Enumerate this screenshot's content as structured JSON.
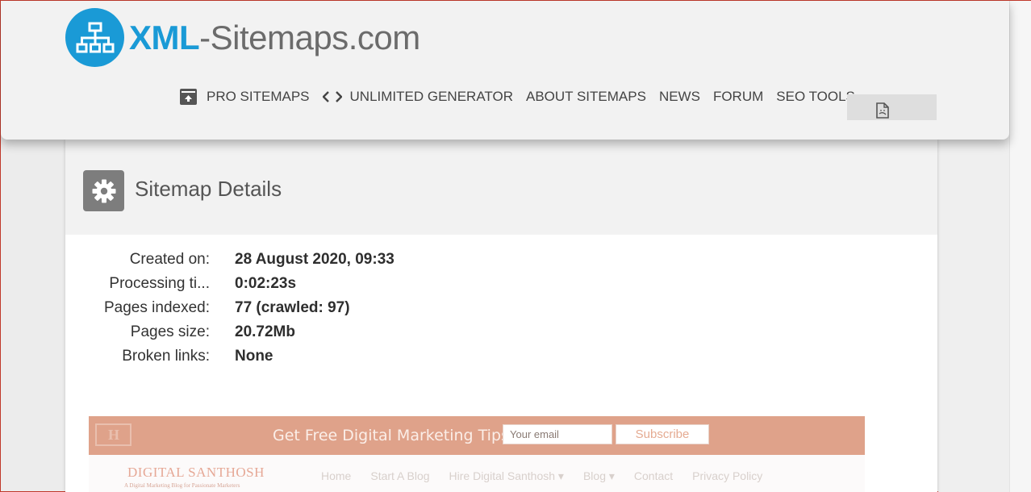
{
  "logo": {
    "brand_prefix": "XML",
    "brand_suffix": "-Sitemaps.com"
  },
  "nav": {
    "items": [
      {
        "label": "PRO SITEMAPS",
        "icon": "archive-icon"
      },
      {
        "label": "UNLIMITED GENERATOR",
        "icon": "code-icon"
      },
      {
        "label": "ABOUT SITEMAPS"
      },
      {
        "label": "NEWS"
      },
      {
        "label": "FORUM"
      },
      {
        "label": "SEO TOOLS"
      }
    ],
    "language_icon": "document-icon"
  },
  "card": {
    "title": "Sitemap Details",
    "icon": "gear-icon",
    "details": [
      {
        "label": "Created on:",
        "value": "28 August 2020, 09:33"
      },
      {
        "label": "Processing ti...",
        "value": "0:02:23s"
      },
      {
        "label": "Pages indexed:",
        "value": "77 (crawled: 97)"
      },
      {
        "label": "Pages size:",
        "value": "20.72Mb"
      },
      {
        "label": "Broken links:",
        "value": "None"
      }
    ]
  },
  "preview": {
    "promo_logo": "H",
    "promo_text": "Get Free Digital Marketing Tips!",
    "email_placeholder": "Your email",
    "subscribe_label": "Subscribe",
    "site_brand": "DIGITAL SANTHOSH",
    "site_tagline": "A Digital Marketing Blog for Passionate Marketers",
    "menu": [
      "Home",
      "Start A Blog",
      "Hire Digital Santhosh ▾",
      "Blog ▾",
      "Contact",
      "Privacy Policy"
    ]
  },
  "colors": {
    "brand_blue": "#1a9ad6",
    "promo_bar": "#dfa28a",
    "gear_box": "#7d7d7d"
  }
}
